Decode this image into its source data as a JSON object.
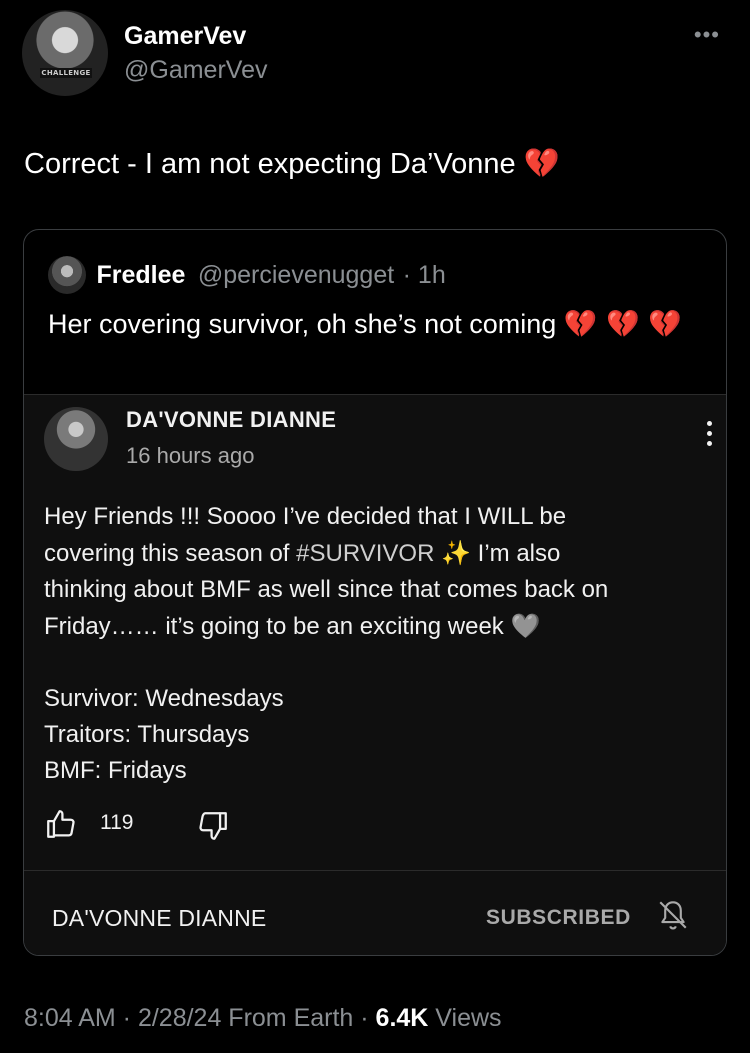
{
  "author": {
    "name": "GamerVev",
    "handle": "@GamerVev",
    "avatar_label": "CHALLENGE",
    "more_icon": "more-horizontal-icon"
  },
  "tweet": {
    "text": "Correct - I am not expecting Da’Vonne",
    "emoji": "💔"
  },
  "quote": {
    "name": "Fredlee",
    "handle": "@percievenugget",
    "time": "· 1h",
    "text": "Her covering survivor, oh she’s not coming",
    "emoji": "💔 💔 💔"
  },
  "yt_post": {
    "channel": "DA'VONNE DIANNE",
    "time": "16 hours ago",
    "line1": "Hey Friends !!! Soooo I’ve decided that I WILL be",
    "line2_pre": "covering this season of ",
    "hashtag": "#SURVIVOR",
    "sparkle": "✨",
    "line2_post": "  I’m also",
    "line3": "thinking about BMF as well since that comes back on",
    "line4": "Friday…… it’s going to be an exciting week",
    "heart": "🩶",
    "schedule": [
      "Survivor: Wednesdays",
      "Traitors: Thursdays",
      "BMF:  Fridays"
    ],
    "likes": "119",
    "footer_channel": "DA'VONNE DIANNE",
    "subscribed_label": "SUBSCRIBED"
  },
  "meta": {
    "time_date": "8:04 AM · 2/28/24 From Earth · ",
    "views_count": "6.4K",
    "views_label": " Views"
  },
  "colors": {
    "background": "#000000",
    "text": "#e7e9ea",
    "muted": "#8b8f93",
    "card": "#0f0f0f"
  }
}
